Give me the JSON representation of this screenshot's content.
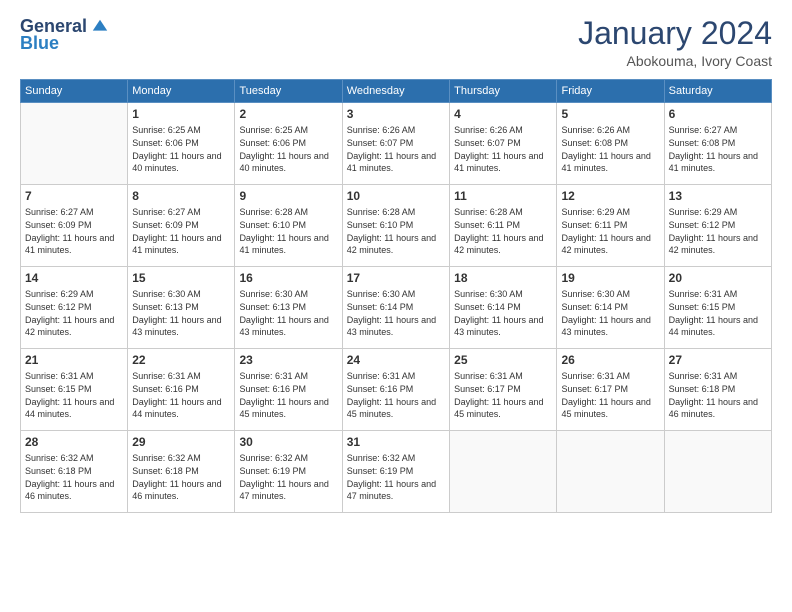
{
  "header": {
    "logo_general": "General",
    "logo_blue": "Blue",
    "month_title": "January 2024",
    "subtitle": "Abokouma, Ivory Coast"
  },
  "weekdays": [
    "Sunday",
    "Monday",
    "Tuesday",
    "Wednesday",
    "Thursday",
    "Friday",
    "Saturday"
  ],
  "weeks": [
    [
      {
        "day": "",
        "sunrise": "",
        "sunset": "",
        "daylight": ""
      },
      {
        "day": "1",
        "sunrise": "Sunrise: 6:25 AM",
        "sunset": "Sunset: 6:06 PM",
        "daylight": "Daylight: 11 hours and 40 minutes."
      },
      {
        "day": "2",
        "sunrise": "Sunrise: 6:25 AM",
        "sunset": "Sunset: 6:06 PM",
        "daylight": "Daylight: 11 hours and 40 minutes."
      },
      {
        "day": "3",
        "sunrise": "Sunrise: 6:26 AM",
        "sunset": "Sunset: 6:07 PM",
        "daylight": "Daylight: 11 hours and 41 minutes."
      },
      {
        "day": "4",
        "sunrise": "Sunrise: 6:26 AM",
        "sunset": "Sunset: 6:07 PM",
        "daylight": "Daylight: 11 hours and 41 minutes."
      },
      {
        "day": "5",
        "sunrise": "Sunrise: 6:26 AM",
        "sunset": "Sunset: 6:08 PM",
        "daylight": "Daylight: 11 hours and 41 minutes."
      },
      {
        "day": "6",
        "sunrise": "Sunrise: 6:27 AM",
        "sunset": "Sunset: 6:08 PM",
        "daylight": "Daylight: 11 hours and 41 minutes."
      }
    ],
    [
      {
        "day": "7",
        "sunrise": "Sunrise: 6:27 AM",
        "sunset": "Sunset: 6:09 PM",
        "daylight": "Daylight: 11 hours and 41 minutes."
      },
      {
        "day": "8",
        "sunrise": "Sunrise: 6:27 AM",
        "sunset": "Sunset: 6:09 PM",
        "daylight": "Daylight: 11 hours and 41 minutes."
      },
      {
        "day": "9",
        "sunrise": "Sunrise: 6:28 AM",
        "sunset": "Sunset: 6:10 PM",
        "daylight": "Daylight: 11 hours and 41 minutes."
      },
      {
        "day": "10",
        "sunrise": "Sunrise: 6:28 AM",
        "sunset": "Sunset: 6:10 PM",
        "daylight": "Daylight: 11 hours and 42 minutes."
      },
      {
        "day": "11",
        "sunrise": "Sunrise: 6:28 AM",
        "sunset": "Sunset: 6:11 PM",
        "daylight": "Daylight: 11 hours and 42 minutes."
      },
      {
        "day": "12",
        "sunrise": "Sunrise: 6:29 AM",
        "sunset": "Sunset: 6:11 PM",
        "daylight": "Daylight: 11 hours and 42 minutes."
      },
      {
        "day": "13",
        "sunrise": "Sunrise: 6:29 AM",
        "sunset": "Sunset: 6:12 PM",
        "daylight": "Daylight: 11 hours and 42 minutes."
      }
    ],
    [
      {
        "day": "14",
        "sunrise": "Sunrise: 6:29 AM",
        "sunset": "Sunset: 6:12 PM",
        "daylight": "Daylight: 11 hours and 42 minutes."
      },
      {
        "day": "15",
        "sunrise": "Sunrise: 6:30 AM",
        "sunset": "Sunset: 6:13 PM",
        "daylight": "Daylight: 11 hours and 43 minutes."
      },
      {
        "day": "16",
        "sunrise": "Sunrise: 6:30 AM",
        "sunset": "Sunset: 6:13 PM",
        "daylight": "Daylight: 11 hours and 43 minutes."
      },
      {
        "day": "17",
        "sunrise": "Sunrise: 6:30 AM",
        "sunset": "Sunset: 6:14 PM",
        "daylight": "Daylight: 11 hours and 43 minutes."
      },
      {
        "day": "18",
        "sunrise": "Sunrise: 6:30 AM",
        "sunset": "Sunset: 6:14 PM",
        "daylight": "Daylight: 11 hours and 43 minutes."
      },
      {
        "day": "19",
        "sunrise": "Sunrise: 6:30 AM",
        "sunset": "Sunset: 6:14 PM",
        "daylight": "Daylight: 11 hours and 43 minutes."
      },
      {
        "day": "20",
        "sunrise": "Sunrise: 6:31 AM",
        "sunset": "Sunset: 6:15 PM",
        "daylight": "Daylight: 11 hours and 44 minutes."
      }
    ],
    [
      {
        "day": "21",
        "sunrise": "Sunrise: 6:31 AM",
        "sunset": "Sunset: 6:15 PM",
        "daylight": "Daylight: 11 hours and 44 minutes."
      },
      {
        "day": "22",
        "sunrise": "Sunrise: 6:31 AM",
        "sunset": "Sunset: 6:16 PM",
        "daylight": "Daylight: 11 hours and 44 minutes."
      },
      {
        "day": "23",
        "sunrise": "Sunrise: 6:31 AM",
        "sunset": "Sunset: 6:16 PM",
        "daylight": "Daylight: 11 hours and 45 minutes."
      },
      {
        "day": "24",
        "sunrise": "Sunrise: 6:31 AM",
        "sunset": "Sunset: 6:16 PM",
        "daylight": "Daylight: 11 hours and 45 minutes."
      },
      {
        "day": "25",
        "sunrise": "Sunrise: 6:31 AM",
        "sunset": "Sunset: 6:17 PM",
        "daylight": "Daylight: 11 hours and 45 minutes."
      },
      {
        "day": "26",
        "sunrise": "Sunrise: 6:31 AM",
        "sunset": "Sunset: 6:17 PM",
        "daylight": "Daylight: 11 hours and 45 minutes."
      },
      {
        "day": "27",
        "sunrise": "Sunrise: 6:31 AM",
        "sunset": "Sunset: 6:18 PM",
        "daylight": "Daylight: 11 hours and 46 minutes."
      }
    ],
    [
      {
        "day": "28",
        "sunrise": "Sunrise: 6:32 AM",
        "sunset": "Sunset: 6:18 PM",
        "daylight": "Daylight: 11 hours and 46 minutes."
      },
      {
        "day": "29",
        "sunrise": "Sunrise: 6:32 AM",
        "sunset": "Sunset: 6:18 PM",
        "daylight": "Daylight: 11 hours and 46 minutes."
      },
      {
        "day": "30",
        "sunrise": "Sunrise: 6:32 AM",
        "sunset": "Sunset: 6:19 PM",
        "daylight": "Daylight: 11 hours and 47 minutes."
      },
      {
        "day": "31",
        "sunrise": "Sunrise: 6:32 AM",
        "sunset": "Sunset: 6:19 PM",
        "daylight": "Daylight: 11 hours and 47 minutes."
      },
      {
        "day": "",
        "sunrise": "",
        "sunset": "",
        "daylight": ""
      },
      {
        "day": "",
        "sunrise": "",
        "sunset": "",
        "daylight": ""
      },
      {
        "day": "",
        "sunrise": "",
        "sunset": "",
        "daylight": ""
      }
    ]
  ]
}
